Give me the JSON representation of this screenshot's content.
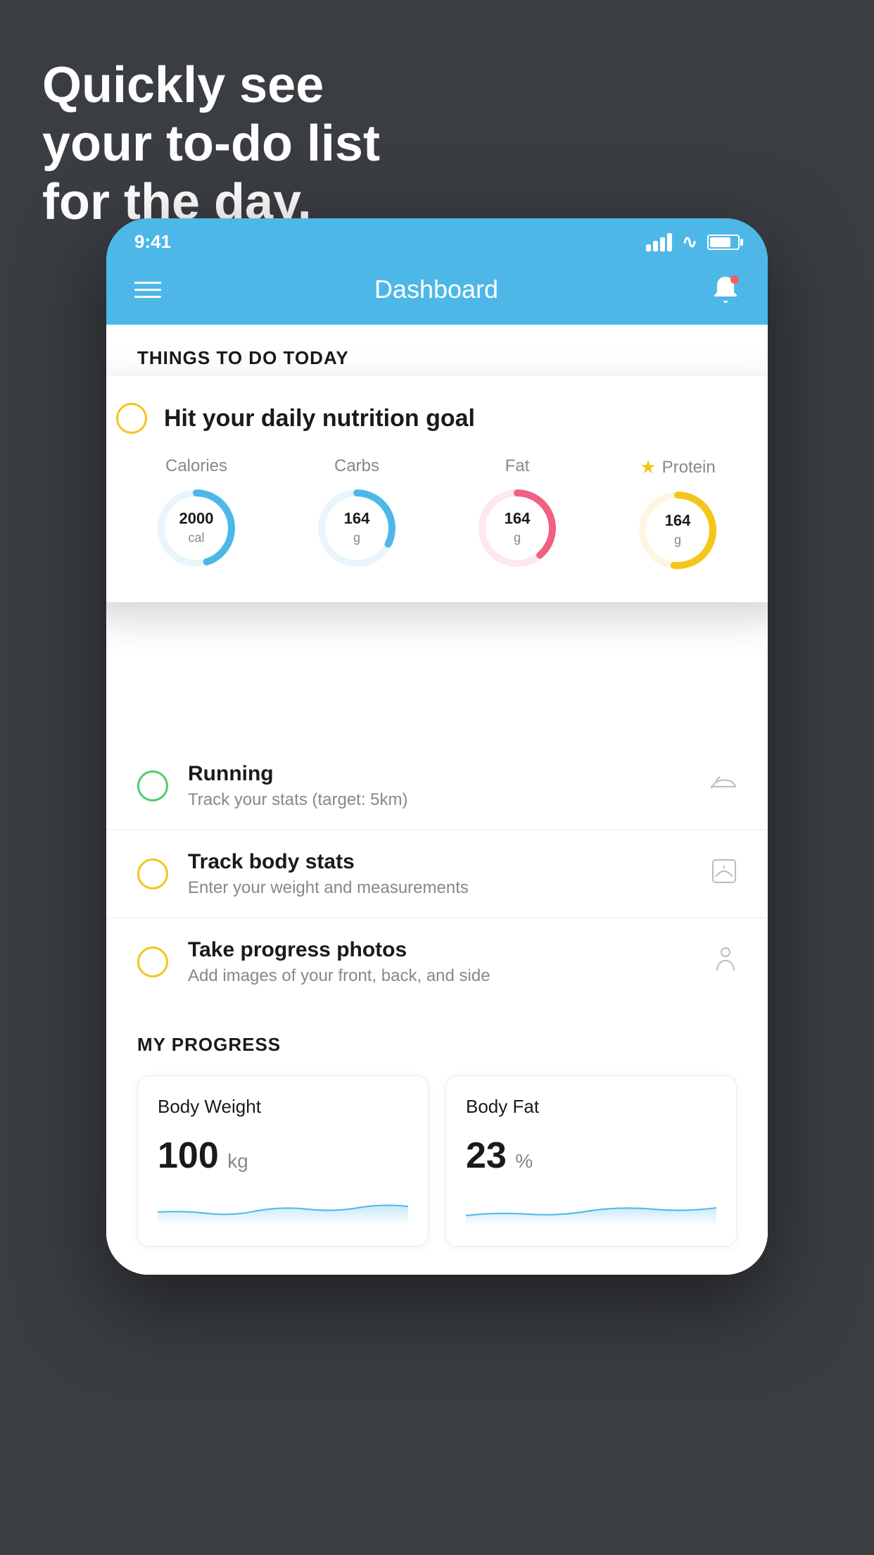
{
  "hero": {
    "line1": "Quickly see",
    "line2": "your to-do list",
    "line3": "for the day."
  },
  "status_bar": {
    "time": "9:41"
  },
  "nav": {
    "title": "Dashboard"
  },
  "section_header": "THINGS TO DO TODAY",
  "nutrition_card": {
    "title": "Hit your daily nutrition goal",
    "metrics": [
      {
        "label": "Calories",
        "value": "2000",
        "unit": "cal",
        "color": "#4db8e8",
        "track_color": "#e8f6fc",
        "starred": false
      },
      {
        "label": "Carbs",
        "value": "164",
        "unit": "g",
        "color": "#4db8e8",
        "track_color": "#e8f6fc",
        "starred": false
      },
      {
        "label": "Fat",
        "value": "164",
        "unit": "g",
        "color": "#f06080",
        "track_color": "#fde8ed",
        "starred": false
      },
      {
        "label": "Protein",
        "value": "164",
        "unit": "g",
        "color": "#f5c518",
        "track_color": "#fdf6e3",
        "starred": true
      }
    ]
  },
  "todo_items": [
    {
      "title": "Running",
      "subtitle": "Track your stats (target: 5km)",
      "circle_color": "green",
      "icon": "shoe"
    },
    {
      "title": "Track body stats",
      "subtitle": "Enter your weight and measurements",
      "circle_color": "yellow",
      "icon": "scale"
    },
    {
      "title": "Take progress photos",
      "subtitle": "Add images of your front, back, and side",
      "circle_color": "yellow",
      "icon": "person"
    }
  ],
  "progress": {
    "section_title": "MY PROGRESS",
    "cards": [
      {
        "title": "Body Weight",
        "value": "100",
        "unit": "kg"
      },
      {
        "title": "Body Fat",
        "value": "23",
        "unit": "%"
      }
    ]
  }
}
